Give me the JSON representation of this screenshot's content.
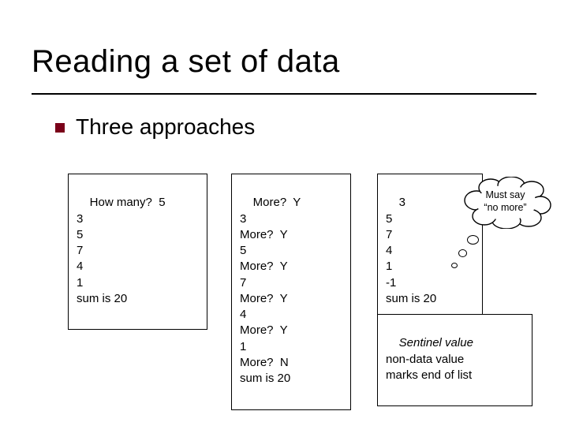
{
  "title": "Reading a set of data",
  "bullet": "Three approaches",
  "approach1": {
    "text": "How many?  5\n3\n5\n7\n4\n1\nsum is 20"
  },
  "approach2": {
    "text": "More?  Y\n3\nMore?  Y\n5\nMore?  Y\n7\nMore?  Y\n4\nMore?  Y\n1\nMore?  N\nsum is 20"
  },
  "approach3": {
    "text": "3\n5\n7\n4\n1\n-1\nsum is 20"
  },
  "cloud": {
    "line1": "Must say",
    "line2": "“no more”"
  },
  "sentinel": {
    "title": "Sentinel value",
    "desc": "non-data value\nmarks end of list"
  }
}
